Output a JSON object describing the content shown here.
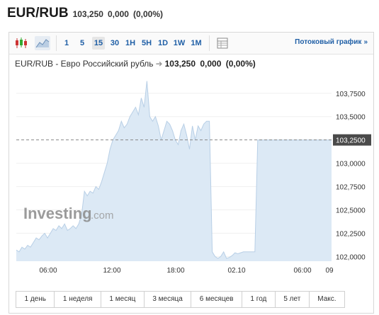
{
  "header": {
    "symbol": "EUR/RUB",
    "price": "103,250",
    "change": "0,000",
    "change_pct": "(0,00%)"
  },
  "toolbar": {
    "icons": [
      "candlestick-icon",
      "area-chart-icon",
      "table-icon"
    ],
    "intervals": [
      {
        "label": "1",
        "active": false
      },
      {
        "label": "5",
        "active": false
      },
      {
        "label": "15",
        "active": true
      },
      {
        "label": "30",
        "active": false
      },
      {
        "label": "1H",
        "active": false
      },
      {
        "label": "5H",
        "active": false
      },
      {
        "label": "1D",
        "active": false
      },
      {
        "label": "1W",
        "active": false
      },
      {
        "label": "1M",
        "active": false
      }
    ],
    "stream_label": "Потоковый график",
    "stream_arrow": "»"
  },
  "subtitle": {
    "name": "EUR/RUB - Евро Российский рубль",
    "arrow": "➜",
    "price": "103,250",
    "change": "0,000",
    "change_pct": "(0,00%)"
  },
  "chart_data": {
    "type": "area",
    "watermark": "Investing.com",
    "current_value": 103.25,
    "current_label": "103,2500",
    "ylim": [
      101.95,
      103.9
    ],
    "y_ticks": [
      {
        "value": 102.0,
        "label": "102,0000"
      },
      {
        "value": 102.25,
        "label": "102,2500"
      },
      {
        "value": 102.5,
        "label": "102,5000"
      },
      {
        "value": 102.75,
        "label": "102,7500"
      },
      {
        "value": 103.0,
        "label": "103,0000"
      },
      {
        "value": 103.5,
        "label": "103,5000"
      },
      {
        "value": 103.75,
        "label": "103,7500"
      }
    ],
    "x_ticks": [
      "06:00",
      "12:00",
      "18:00",
      "02.10",
      "06:00",
      "09"
    ],
    "series": [
      {
        "values": [
          102.07,
          102.05,
          102.1,
          102.08,
          102.12,
          102.1,
          102.15,
          102.2,
          102.18,
          102.22,
          102.25,
          102.2,
          102.25,
          102.3,
          102.28,
          102.33,
          102.3,
          102.35,
          102.28,
          102.3,
          102.33,
          102.3,
          102.35,
          102.45,
          102.7,
          102.65,
          102.7,
          102.68,
          102.75,
          102.72,
          102.8,
          102.9,
          103.0,
          103.15,
          103.25,
          103.3,
          103.35,
          103.45,
          103.38,
          103.42,
          103.5,
          103.55,
          103.6,
          103.52,
          103.7,
          103.6,
          103.88,
          103.5,
          103.45,
          103.5,
          103.4,
          103.25,
          103.35,
          103.45,
          103.42,
          103.35,
          103.25,
          103.2,
          103.35,
          103.42,
          103.3,
          103.15,
          103.4,
          103.25,
          103.4,
          103.35,
          103.42,
          103.45,
          103.45,
          102.05,
          102.0,
          101.98,
          102.0,
          102.05,
          101.98,
          101.99,
          102.01,
          102.04,
          102.03,
          102.04,
          102.05,
          102.05,
          102.05,
          102.05,
          102.05,
          103.25,
          103.25,
          103.25,
          103.25,
          103.25,
          103.25,
          103.25,
          103.25,
          103.25,
          103.25,
          103.25,
          103.25,
          103.25,
          103.25,
          103.25,
          103.25,
          103.25,
          103.25,
          103.25,
          103.25,
          103.25,
          103.25,
          103.25,
          103.25,
          103.25,
          103.25,
          103.25
        ]
      }
    ],
    "grid": true
  },
  "periods": [
    "1 день",
    "1 неделя",
    "1 месяц",
    "3 месяца",
    "6 месяцев",
    "1 год",
    "5 лет",
    "Макс."
  ],
  "colors": {
    "area_fill": "#dce9f5",
    "line": "#b8cfe6",
    "accent": "#1f5fa6",
    "current_box": "#4a4a4a"
  }
}
